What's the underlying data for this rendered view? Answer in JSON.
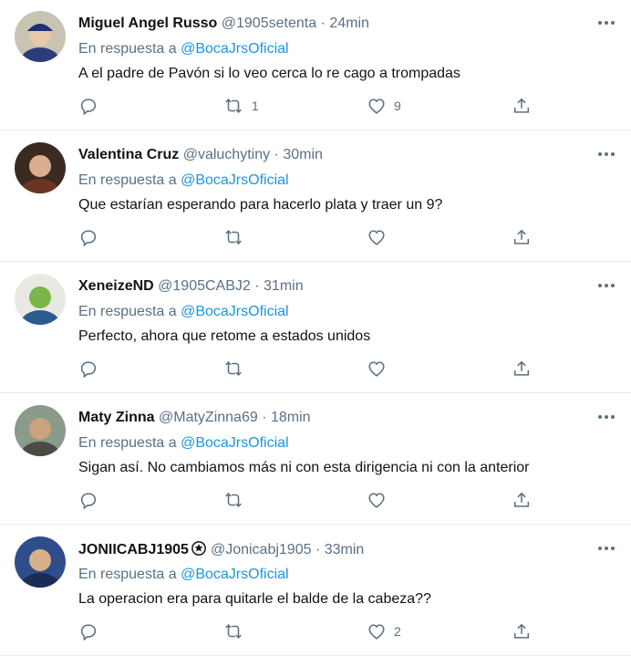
{
  "accent_color": "#1b95e0",
  "tweets": [
    {
      "name": "Miguel Angel Russo",
      "handle": "@1905setenta",
      "separator": "·",
      "time": "24min",
      "verified": false,
      "reply_prefix": "En respuesta a",
      "reply_to": "@BocaJrsOficial",
      "text": "A el padre de Pavón si lo veo cerca lo re cago a trompadas",
      "retweets": "1",
      "likes": "9",
      "avatar": "avatar-photo"
    },
    {
      "name": "Valentina Cruz",
      "handle": "@valuchytiny",
      "separator": "·",
      "time": "30min",
      "verified": false,
      "reply_prefix": "En respuesta a",
      "reply_to": "@BocaJrsOficial",
      "text": "Que estarían esperando para hacerlo plata y traer un 9?",
      "retweets": "",
      "likes": "",
      "avatar": "avatar-photo"
    },
    {
      "name": "XeneizeND",
      "handle": "@1905CABJ2",
      "separator": "·",
      "time": "31min",
      "verified": false,
      "reply_prefix": "En respuesta a",
      "reply_to": "@BocaJrsOficial",
      "text": "Perfecto, ahora que retome a estados unidos",
      "retweets": "",
      "likes": "",
      "avatar": "avatar-photo"
    },
    {
      "name": "Maty Zinna",
      "handle": "@MatyZinna69",
      "separator": "·",
      "time": "18min",
      "verified": false,
      "reply_prefix": "En respuesta a",
      "reply_to": "@BocaJrsOficial",
      "text": "Sigan así. No cambiamos más ni con esta dirigencia ni con la anterior",
      "retweets": "",
      "likes": "",
      "avatar": "avatar-photo"
    },
    {
      "name": "JONIICABJ1905",
      "handle": "@Jonicabj1905",
      "separator": "·",
      "time": "33min",
      "verified": true,
      "reply_prefix": "En respuesta a",
      "reply_to": "@BocaJrsOficial",
      "text": "La operacion era para quitarle el balde de la cabeza??",
      "retweets": "",
      "likes": "2",
      "avatar": "avatar-photo"
    }
  ]
}
